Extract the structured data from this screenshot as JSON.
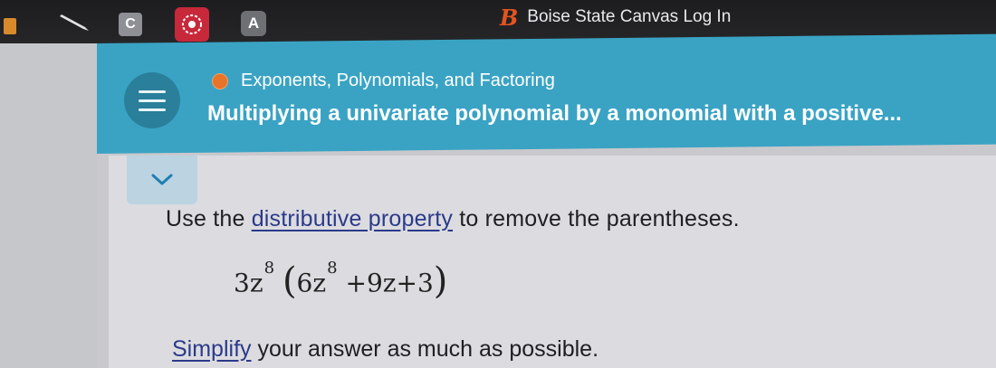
{
  "bookmarks": {
    "folder_icon": "folder-icon",
    "pen_icon": "pen-icon",
    "c_label": "C",
    "star_icon": "red-badge-icon",
    "a_label": "A",
    "boise_icon": "B",
    "boise_label": "Boise State Canvas Log In"
  },
  "header": {
    "menu_icon": "hamburger-icon",
    "topic": "Exponents, Polynomials, and Factoring",
    "title": "Multiplying a univariate polynomial by a monomial with a positive...",
    "topic_dot_color": "#e8742a",
    "bg_color": "#3aa3c4"
  },
  "content": {
    "collapse_icon": "chevron-down-icon",
    "instruction_pre": "Use the ",
    "instruction_link": "distributive property",
    "instruction_post": " to remove the parentheses.",
    "math": {
      "coef1": "3z",
      "exp1": "8",
      "open": "(",
      "coef2": "6z",
      "exp2": "8",
      "rest": "+9z+3",
      "close": ")"
    },
    "simplify_link": "Simplify",
    "simplify_post": " your answer as much as possible."
  }
}
